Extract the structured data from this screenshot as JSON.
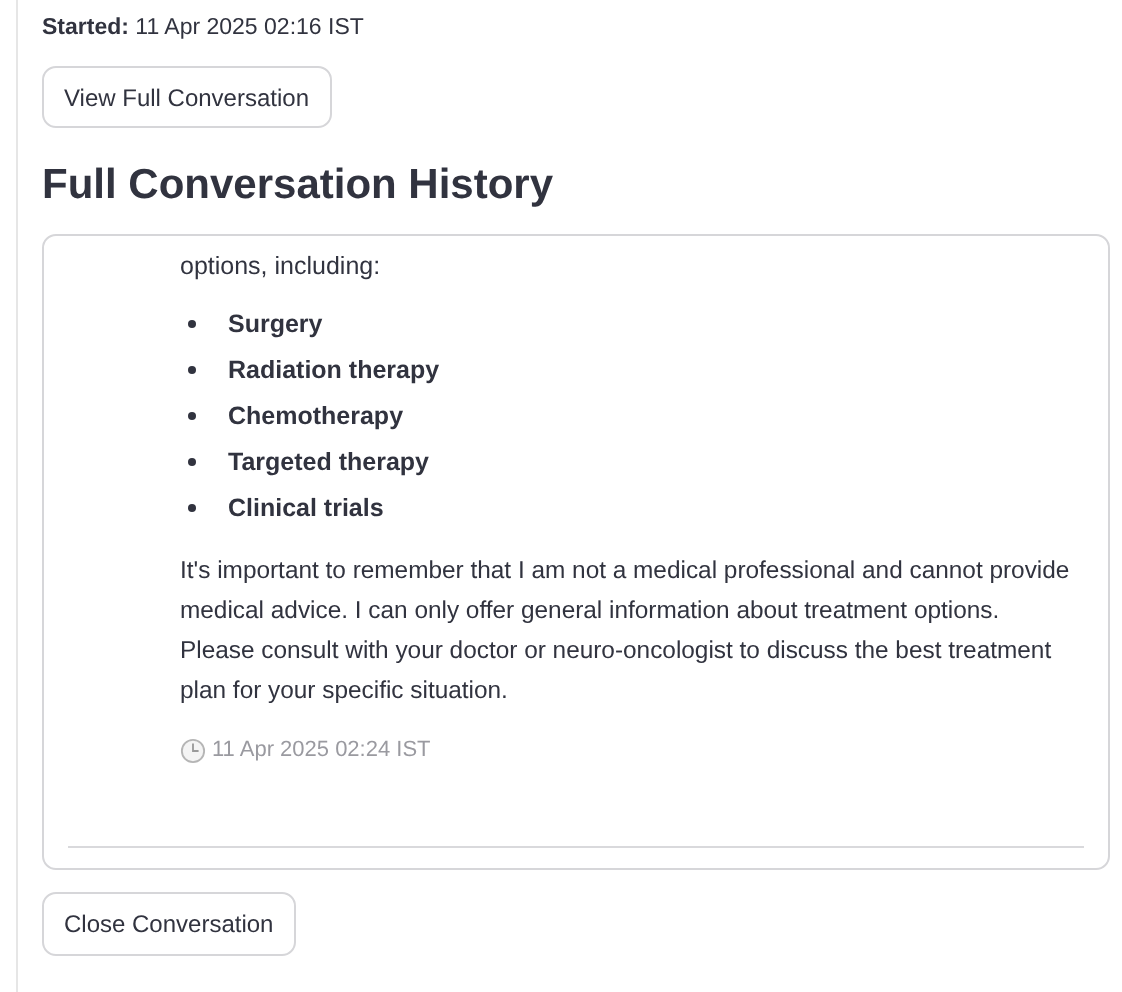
{
  "started": {
    "label": "Started:",
    "value": "11 Apr 2025 02:16 IST"
  },
  "view_button": "View Full Conversation",
  "heading": "Full Conversation History",
  "message": {
    "intro": "options, including:",
    "items": [
      "Surgery",
      "Radiation therapy",
      "Chemotherapy",
      "Targeted therapy",
      "Clinical trials"
    ],
    "paragraph": "It's important to remember that I am not a medical professional and cannot provide medical advice. I can only offer general information about treatment options. Please consult with your doctor or neuro-oncologist to discuss the best treatment plan for your specific situation.",
    "timestamp": "11 Apr 2025 02:24 IST"
  },
  "close_button": "Close Conversation"
}
